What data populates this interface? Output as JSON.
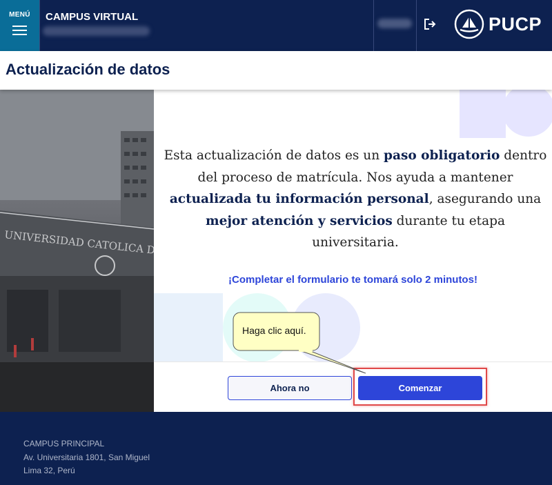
{
  "header": {
    "menu_label": "MENÚ",
    "app_title": "CAMPUS VIRTUAL",
    "logo_text": "PUCP"
  },
  "page": {
    "title": "Actualización de datos"
  },
  "modal": {
    "para_1": "Esta actualización de datos es un ",
    "para_2": "paso obligatorio",
    "para_3": " dentro del proceso de matrícula. Nos ayuda a mantener ",
    "para_4": "actualizada tu información personal",
    "para_5": ", asegurando una ",
    "para_6": "mejor atención y servicios",
    "para_7": " durante tu etapa universitaria.",
    "highlight": "¡Completar el formulario te tomará solo 2 minutos!",
    "btn_secondary": "Ahora no",
    "btn_primary": "Comenzar"
  },
  "callout": {
    "text": "Haga clic aquí."
  },
  "footer": {
    "line1": "CAMPUS PRINCIPAL",
    "line2": "Av. Universitaria 1801, San Miguel",
    "line3": "Lima 32, Perú"
  },
  "colors": {
    "navy": "#0d2150",
    "teal": "#0a6d98",
    "accent_blue": "#2d45d9",
    "highlight_red": "#e04848",
    "callout_yellow": "#ffffc4"
  },
  "icons": [
    "menu-icon",
    "logout-icon",
    "pucp-logo"
  ]
}
